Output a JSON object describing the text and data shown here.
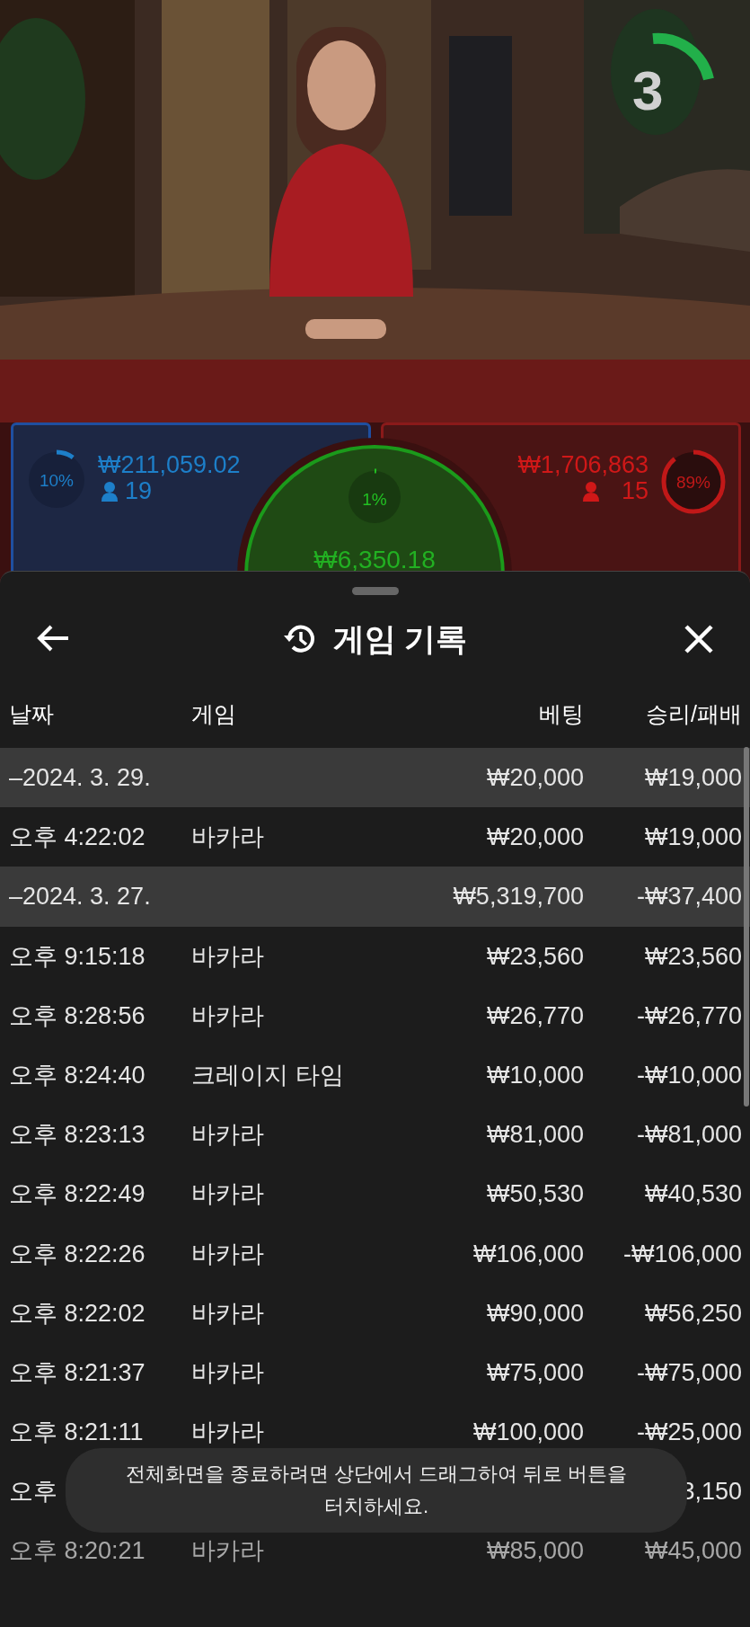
{
  "video": {
    "countdown": "3"
  },
  "bets": {
    "player": {
      "percent": "10%",
      "level": 0.1,
      "amount": "₩211,059.02",
      "players": "19"
    },
    "tie": {
      "percent": "1%",
      "level": 0.01,
      "amount": "₩6,350.18"
    },
    "banker": {
      "percent": "89%",
      "level": 0.89,
      "amount": "₩1,706,863",
      "players": "15"
    }
  },
  "sheet": {
    "title": "게임 기록",
    "columns": [
      "날짜",
      "게임",
      "베팅",
      "승리/패배"
    ],
    "rows": [
      {
        "kind": "date",
        "date": "–2024. 3. 29.",
        "bet": "₩20,000",
        "result": "₩19,000"
      },
      {
        "kind": "entry",
        "time": "오후 4:22:02",
        "game": "바카라",
        "bet": "₩20,000",
        "result": "₩19,000"
      },
      {
        "kind": "date",
        "date": "–2024. 3. 27.",
        "bet": "₩5,319,700",
        "result": "-₩37,400"
      },
      {
        "kind": "entry",
        "time": "오후 9:15:18",
        "game": "바카라",
        "bet": "₩23,560",
        "result": "₩23,560"
      },
      {
        "kind": "entry",
        "time": "오후 8:28:56",
        "game": "바카라",
        "bet": "₩26,770",
        "result": "-₩26,770"
      },
      {
        "kind": "entry",
        "time": "오후 8:24:40",
        "game": "크레이지 타임",
        "bet": "₩10,000",
        "result": "-₩10,000"
      },
      {
        "kind": "entry",
        "time": "오후 8:23:13",
        "game": "바카라",
        "bet": "₩81,000",
        "result": "-₩81,000"
      },
      {
        "kind": "entry",
        "time": "오후 8:22:49",
        "game": "바카라",
        "bet": "₩50,530",
        "result": "₩40,530"
      },
      {
        "kind": "entry",
        "time": "오후 8:22:26",
        "game": "바카라",
        "bet": "₩106,000",
        "result": "-₩106,000"
      },
      {
        "kind": "entry",
        "time": "오후 8:22:02",
        "game": "바카라",
        "bet": "₩90,000",
        "result": "₩56,250"
      },
      {
        "kind": "entry",
        "time": "오후 8:21:37",
        "game": "바카라",
        "bet": "₩75,000",
        "result": "-₩75,000"
      },
      {
        "kind": "entry",
        "time": "오후 8:21:11",
        "game": "바카라",
        "bet": "₩100,000",
        "result": "-₩25,000"
      },
      {
        "kind": "entry",
        "time": "오후",
        "result": "3,150"
      },
      {
        "kind": "entry",
        "time": "오후 8:20:21",
        "game": "바카라",
        "bet": "₩85,000",
        "result": "₩45,000"
      }
    ]
  },
  "toast": "전체화면을 종료하려면 상단에서 드래그하여 뒤로 버튼을 터치하세요."
}
